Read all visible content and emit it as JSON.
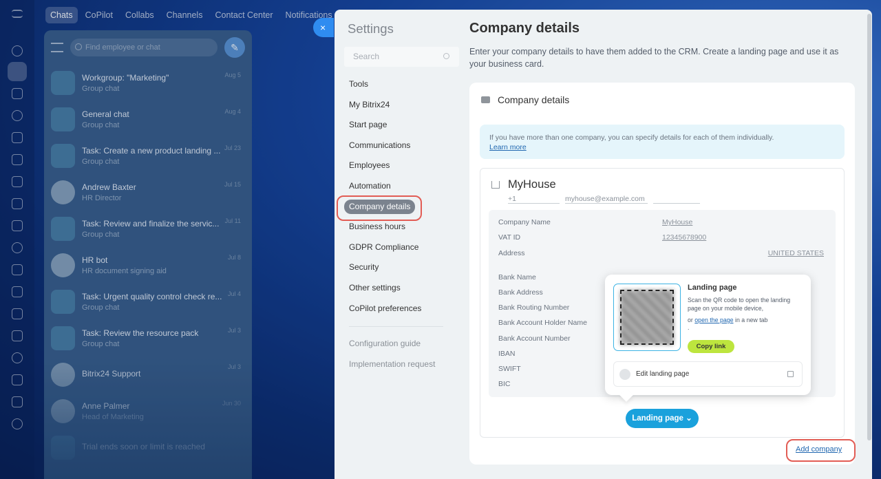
{
  "top_nav": {
    "tabs": [
      "Chats",
      "CoPilot",
      "Collabs",
      "Channels",
      "Contact Center",
      "Notifications"
    ],
    "active": "Chats"
  },
  "chat_panel": {
    "search_placeholder": "Find employee or chat",
    "chats": [
      {
        "name": "Workgroup: \"Marketing\"",
        "sub": "Group chat",
        "date": "Aug 5"
      },
      {
        "name": "General chat",
        "sub": "Group chat",
        "date": "Aug 4"
      },
      {
        "name": "Task: Create a new product landing ...",
        "sub": "Group chat",
        "date": "Jul 23"
      },
      {
        "name": "Andrew Baxter",
        "sub": "HR Director",
        "date": "Jul 15"
      },
      {
        "name": "Task: Review and finalize the servic...",
        "sub": "Group chat",
        "date": "Jul 11"
      },
      {
        "name": "HR bot",
        "sub": "HR document signing aid",
        "date": "Jul 8"
      },
      {
        "name": "Task: Urgent quality control check re...",
        "sub": "Group chat",
        "date": "Jul 4"
      },
      {
        "name": "Task: Review the resource pack",
        "sub": "Group chat",
        "date": "Jul 3"
      },
      {
        "name": "Bitrix24 Support",
        "sub": "",
        "date": "Jul 3"
      },
      {
        "name": "Anne Palmer",
        "sub": "Head of Marketing",
        "date": "Jun 30"
      },
      {
        "name": "Trial ends soon or limit is reached",
        "sub": "",
        "date": ""
      }
    ]
  },
  "close_icon": "×",
  "settings": {
    "title": "Settings",
    "search_placeholder": "Search",
    "menu": [
      "Tools",
      "My Bitrix24",
      "Start page",
      "Communications",
      "Employees",
      "Automation",
      "Company details",
      "Business hours",
      "GDPR Compliance",
      "Security",
      "Other settings",
      "CoPilot preferences"
    ],
    "active_item": "Company details",
    "menu_secondary": [
      "Configuration guide",
      "Implementation request"
    ]
  },
  "page": {
    "title": "Company details",
    "description": "Enter your company details to have them added to the CRM. Create a landing page and use it as your business card.",
    "card_title": "Company details",
    "info_text": "If you have more than one company, you can specify details for each of them individually.",
    "info_link": "Learn more"
  },
  "company": {
    "name": "MyHouse",
    "phone": "+1",
    "email": "myhouse@example.com",
    "fields": [
      {
        "label": "Company Name",
        "value": "MyHouse"
      },
      {
        "label": "VAT ID",
        "value": "12345678900"
      },
      {
        "label": "Address",
        "value": "UNITED STATES"
      },
      {
        "label": "Bank Name",
        "value": ""
      },
      {
        "label": "Bank Address",
        "value": ""
      },
      {
        "label": "Bank Routing Number",
        "value": ""
      },
      {
        "label": "Bank Account Holder Name",
        "value": ""
      },
      {
        "label": "Bank Account Number",
        "value": ""
      },
      {
        "label": "IBAN",
        "value": ""
      },
      {
        "label": "SWIFT",
        "value": ""
      },
      {
        "label": "BIC",
        "value": ""
      }
    ],
    "landing_button": "Landing page"
  },
  "popup": {
    "title": "Landing page",
    "desc": "Scan the QR code to open the landing page on your mobile device,",
    "or_text": "or",
    "open_link": "open the page",
    "in_new_tab": "in a new tab",
    "dot": ".",
    "copy_button": "Copy link",
    "edit_label": "Edit landing page"
  },
  "add_company": "Add company",
  "colors": {
    "accent": "#1aa1dc",
    "highlight": "#e25c54",
    "copy_button": "#bde53e",
    "active_menu": "#7b838e"
  }
}
